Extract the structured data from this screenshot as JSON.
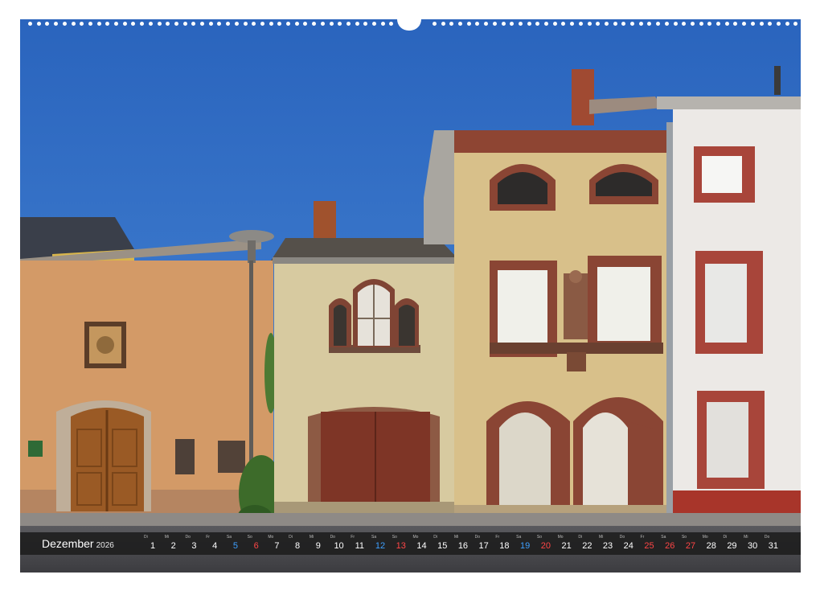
{
  "calendar": {
    "month": "Dezember",
    "year": "2026",
    "days": [
      {
        "wd": "Di",
        "d": "1",
        "kind": "weekday"
      },
      {
        "wd": "Mi",
        "d": "2",
        "kind": "weekday"
      },
      {
        "wd": "Do",
        "d": "3",
        "kind": "weekday"
      },
      {
        "wd": "Fr",
        "d": "4",
        "kind": "weekday"
      },
      {
        "wd": "Sa",
        "d": "5",
        "kind": "sat"
      },
      {
        "wd": "So",
        "d": "6",
        "kind": "sun"
      },
      {
        "wd": "Mo",
        "d": "7",
        "kind": "weekday"
      },
      {
        "wd": "Di",
        "d": "8",
        "kind": "weekday"
      },
      {
        "wd": "Mi",
        "d": "9",
        "kind": "weekday"
      },
      {
        "wd": "Do",
        "d": "10",
        "kind": "weekday"
      },
      {
        "wd": "Fr",
        "d": "11",
        "kind": "weekday"
      },
      {
        "wd": "Sa",
        "d": "12",
        "kind": "sat"
      },
      {
        "wd": "So",
        "d": "13",
        "kind": "sun"
      },
      {
        "wd": "Mo",
        "d": "14",
        "kind": "weekday"
      },
      {
        "wd": "Di",
        "d": "15",
        "kind": "weekday"
      },
      {
        "wd": "Mi",
        "d": "16",
        "kind": "weekday"
      },
      {
        "wd": "Do",
        "d": "17",
        "kind": "weekday"
      },
      {
        "wd": "Fr",
        "d": "18",
        "kind": "weekday"
      },
      {
        "wd": "Sa",
        "d": "19",
        "kind": "sat"
      },
      {
        "wd": "So",
        "d": "20",
        "kind": "sun"
      },
      {
        "wd": "Mo",
        "d": "21",
        "kind": "weekday"
      },
      {
        "wd": "Di",
        "d": "22",
        "kind": "weekday"
      },
      {
        "wd": "Mi",
        "d": "23",
        "kind": "weekday"
      },
      {
        "wd": "Do",
        "d": "24",
        "kind": "weekday"
      },
      {
        "wd": "Fr",
        "d": "25",
        "kind": "hol"
      },
      {
        "wd": "Sa",
        "d": "26",
        "kind": "hol"
      },
      {
        "wd": "So",
        "d": "27",
        "kind": "sun"
      },
      {
        "wd": "Mo",
        "d": "28",
        "kind": "weekday"
      },
      {
        "wd": "Di",
        "d": "29",
        "kind": "weekday"
      },
      {
        "wd": "Mi",
        "d": "30",
        "kind": "weekday"
      },
      {
        "wd": "Do",
        "d": "31",
        "kind": "weekday"
      }
    ]
  },
  "colors": {
    "sky": "#2f6fc4",
    "bar": "#1c1c1c",
    "weekday_text": "#ffffff",
    "saturday_text": "#3ea0ff",
    "sunday_holiday_text": "#ff4646"
  },
  "photo": {
    "subject": "row of old house facades with arched doors and windows under a blue sky"
  }
}
